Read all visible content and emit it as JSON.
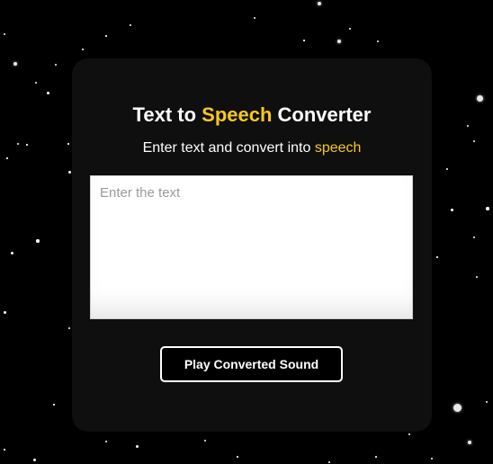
{
  "heading": {
    "prefix": "Text to ",
    "highlight": "Speech",
    "suffix": " Converter"
  },
  "subheading": {
    "prefix": "Enter text and convert into ",
    "highlight": "speech"
  },
  "input": {
    "value": "",
    "placeholder": "Enter the text"
  },
  "play_button": {
    "label": "Play Converted Sound"
  },
  "colors": {
    "page_background": "#000000",
    "card_background": "#0f0f0f",
    "accent": "#f7c81e",
    "text": "#ffffff"
  }
}
